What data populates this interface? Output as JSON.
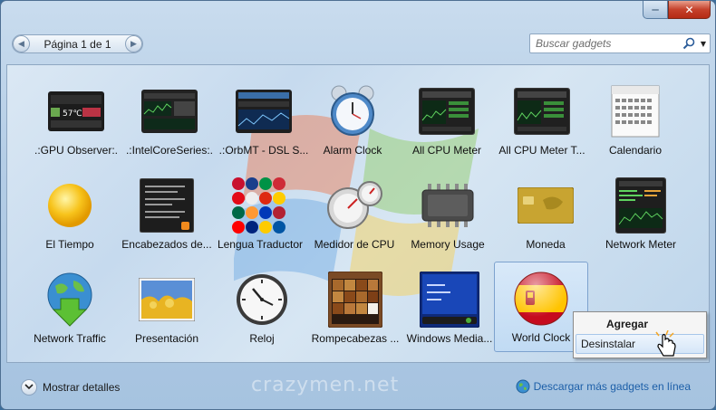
{
  "window": {
    "minimize_glyph": "─",
    "close_glyph": "✕"
  },
  "toolbar": {
    "page_label": "Página 1 de 1",
    "prev_glyph": "◀",
    "next_glyph": "▶",
    "search_placeholder": "Buscar gadgets",
    "dropdown_glyph": "▼"
  },
  "gadgets": [
    {
      "label": ".:GPU Observer:.",
      "icon": "gpu-monitor-icon"
    },
    {
      "label": ".:IntelCoreSeries:.",
      "icon": "cpu-graph-icon"
    },
    {
      "label": ".:OrbMT - DSL S...",
      "icon": "dsl-connection-icon"
    },
    {
      "label": "Alarm Clock",
      "icon": "alarm-clock-icon"
    },
    {
      "label": "All CPU Meter",
      "icon": "cpu-meter-icon"
    },
    {
      "label": "All CPU Meter T...",
      "icon": "cpu-meter-icon"
    },
    {
      "label": "Calendario",
      "icon": "calendar-icon"
    },
    {
      "label": "El Tiempo",
      "icon": "sun-icon"
    },
    {
      "label": "Encabezados de...",
      "icon": "rss-headlines-icon"
    },
    {
      "label": "Lengua Traductor",
      "icon": "flags-icon"
    },
    {
      "label": "Medidor de CPU",
      "icon": "gauge-icon"
    },
    {
      "label": "Memory Usage",
      "icon": "memory-chip-icon"
    },
    {
      "label": "Moneda",
      "icon": "currency-card-icon"
    },
    {
      "label": "Network Meter",
      "icon": "network-meter-icon"
    },
    {
      "label": "Network Traffic",
      "icon": "globe-arrow-icon"
    },
    {
      "label": "Presentación",
      "icon": "slideshow-icon"
    },
    {
      "label": "Reloj",
      "icon": "wall-clock-icon"
    },
    {
      "label": "Rompecabezas ...",
      "icon": "puzzle-icon"
    },
    {
      "label": "Windows Media...",
      "icon": "media-center-icon"
    },
    {
      "label": "World Clock",
      "icon": "spain-flag-icon",
      "selected": true
    }
  ],
  "context_menu": {
    "items": [
      {
        "label": "Agregar",
        "bold": true
      },
      {
        "label": "Desinstalar",
        "hover": true
      }
    ]
  },
  "statusbar": {
    "details_label": "Mostrar detalles",
    "watermark": "crazymen.net",
    "download_label": "Descargar más gadgets en línea"
  },
  "colors": {
    "accent": "#1d5fa8",
    "close_red": "#c5412b",
    "selection": "#7da2ce"
  }
}
